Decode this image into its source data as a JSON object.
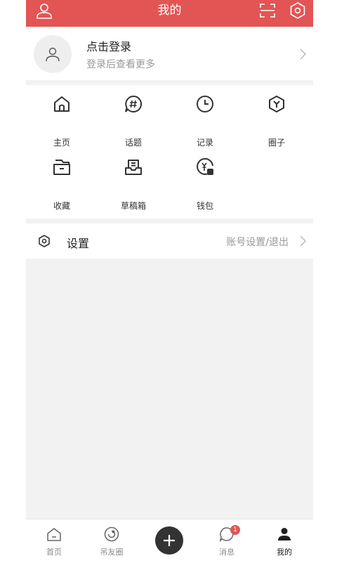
{
  "header": {
    "title": "我的"
  },
  "login": {
    "title": "点击登录",
    "subtitle": "登录后查看更多"
  },
  "features": [
    {
      "label": "主页",
      "icon": "home-icon"
    },
    {
      "label": "话题",
      "icon": "hashtag-icon"
    },
    {
      "label": "记录",
      "icon": "clock-icon"
    },
    {
      "label": "圈子",
      "icon": "hexagon-icon"
    },
    {
      "label": "收藏",
      "icon": "folder-icon"
    },
    {
      "label": "草稿箱",
      "icon": "inbox-icon"
    },
    {
      "label": "钱包",
      "icon": "wallet-icon"
    }
  ],
  "settings": {
    "label": "设置",
    "hint": "账号设置/退出"
  },
  "tabbar": {
    "items": [
      {
        "label": "首页",
        "icon": "home-tab-icon"
      },
      {
        "label": "吊友圈",
        "icon": "circle-friends-icon"
      },
      {
        "label": "消息",
        "icon": "message-icon",
        "badge": "1"
      },
      {
        "label": "我的",
        "icon": "profile-icon"
      }
    ]
  },
  "colors": {
    "accent": "#e35454",
    "background": "#f2f2f2",
    "plus_button": "#333333"
  }
}
